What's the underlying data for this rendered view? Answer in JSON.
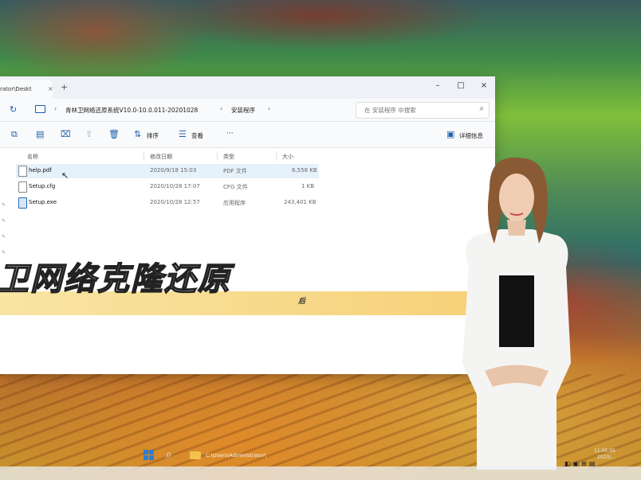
{
  "window": {
    "tab_title": "rator\\Deskt",
    "tab_close": "×",
    "new_tab": "+",
    "minimize": "–",
    "maximize": "□",
    "close": "×"
  },
  "address": {
    "path": [
      "青林卫网络还原系统V10.0-10.0.011-20201028",
      "安装程序"
    ],
    "search_placeholder": "在 安装程序 中搜索"
  },
  "toolbar": {
    "sort_label": "排序",
    "view_label": "查看",
    "more_label": "···",
    "details_label": "详细信息"
  },
  "columns": [
    "名称",
    "修改日期",
    "类型",
    "大小"
  ],
  "files": [
    {
      "name": "help.pdf",
      "modified": "2020/9/18 15:03",
      "type": "PDF 文件",
      "size": "6,558 KB",
      "icon": "pdf-file-icon",
      "selected": true
    },
    {
      "name": "Setup.cfg",
      "modified": "2020/10/28 17:07",
      "type": "CFG 文件",
      "size": "1 KB",
      "icon": "cfg-file-icon",
      "selected": false
    },
    {
      "name": "Setup.exe",
      "modified": "2020/10/28 12:57",
      "type": "应用程序",
      "size": "243,401 KB",
      "icon": "exe-file-icon",
      "selected": false
    }
  ],
  "overlay": {
    "caption": "卫网络克隆还原",
    "caption_sub": "后"
  },
  "taskbar": {
    "path_text": "C:\\Users\\Administrator\\",
    "time": "11:05:05",
    "date": "2023/..."
  },
  "colors": {
    "accent": "#1a5fb4",
    "selected_row": "#e5f1fb",
    "caption_band": "#f6cd6e"
  }
}
